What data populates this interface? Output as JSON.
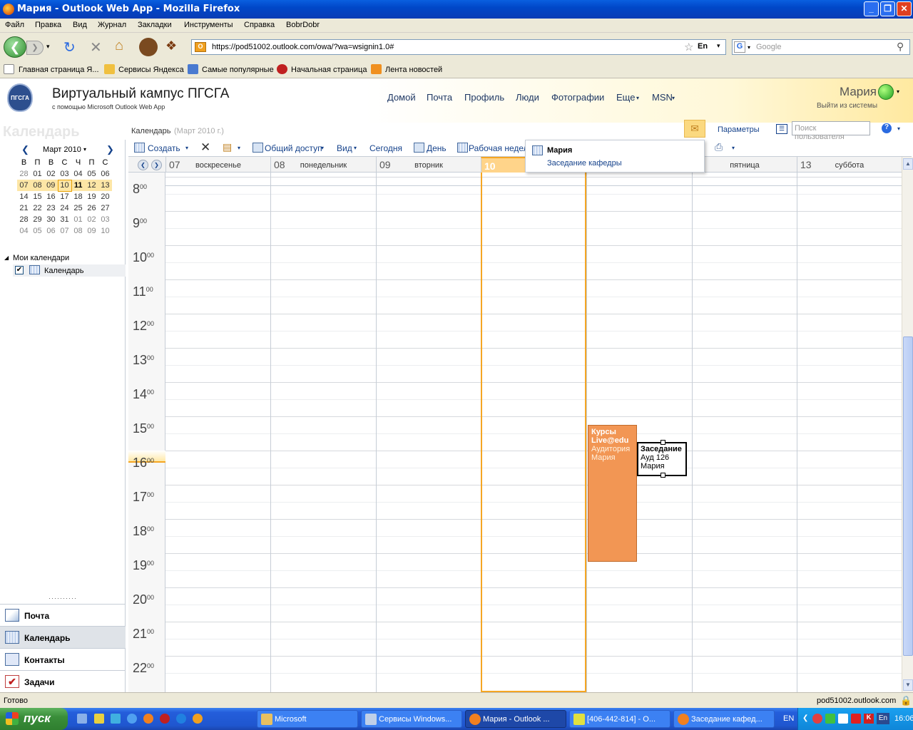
{
  "window": {
    "title": "Мария - Outlook Web App - Mozilla Firefox",
    "min": "_",
    "max": "❐",
    "close": "✕"
  },
  "menu": [
    "Файл",
    "Правка",
    "Вид",
    "Журнал",
    "Закладки",
    "Инструменты",
    "Справка",
    "BobrDobr"
  ],
  "nav": {
    "url": "https://pod51002.outlook.com/owa/?wa=wsignin1.0#",
    "lang": "En",
    "search_placeholder": "Google"
  },
  "bookmarks": [
    "Главная страница Я...",
    "Сервисы Яндекса",
    "Самые популярные",
    "Начальная страница",
    "Лента новостей"
  ],
  "owa": {
    "logo": "ПГСГА",
    "title": "Виртуальный кампус ПГСГА",
    "subtitle": "с помощью Microsoft Outlook Web App",
    "menu": [
      "Домой",
      "Почта",
      "Профиль",
      "Люди",
      "Фотографии",
      "Еще",
      "MSN"
    ],
    "user": "Мария",
    "signout": "Выйти из системы",
    "params": "Параметры",
    "search_users_placeholder": "Поиск пользователя",
    "help": "?"
  },
  "page": {
    "heading": "Календарь",
    "breadcrumb": "Календарь",
    "breadcrumb_date": "(Март 2010 г.)"
  },
  "mini_calendar": {
    "month": "Март 2010",
    "weekdays": [
      "В",
      "П",
      "В",
      "С",
      "Ч",
      "П",
      "С"
    ],
    "weeks": [
      [
        "28",
        "01",
        "02",
        "03",
        "04",
        "05",
        "06"
      ],
      [
        "07",
        "08",
        "09",
        "10",
        "11",
        "12",
        "13"
      ],
      [
        "14",
        "15",
        "16",
        "17",
        "18",
        "19",
        "20"
      ],
      [
        "21",
        "22",
        "23",
        "24",
        "25",
        "26",
        "27"
      ],
      [
        "28",
        "29",
        "30",
        "31",
        "01",
        "02",
        "03"
      ],
      [
        "04",
        "05",
        "06",
        "07",
        "08",
        "09",
        "10"
      ]
    ],
    "selected_week": 1,
    "today": "10"
  },
  "my_calendars": {
    "label": "Мои календари",
    "items": [
      "Календарь"
    ]
  },
  "modules": [
    "Почта",
    "Календарь",
    "Контакты",
    "Задачи"
  ],
  "toolbar": {
    "create": "Создать",
    "share": "Общий доступ",
    "view": "Вид",
    "today": "Сегодня",
    "day": "День",
    "workweek": "Рабочая неделя"
  },
  "days": [
    {
      "num": "07",
      "name": "воскресенье"
    },
    {
      "num": "08",
      "name": "понедельник"
    },
    {
      "num": "09",
      "name": "вторник"
    },
    {
      "num": "10",
      "name": ""
    },
    {
      "num": "11",
      "name": ""
    },
    {
      "num": "12",
      "name": "пятница"
    },
    {
      "num": "13",
      "name": "суббота"
    }
  ],
  "hours": [
    "8",
    "9",
    "10",
    "11",
    "12",
    "13",
    "14",
    "15",
    "16",
    "17",
    "18",
    "19",
    "20",
    "21",
    "22"
  ],
  "hour_suffix": "00",
  "events": [
    {
      "title": "Курсы Live@edu",
      "location": "Аудитория",
      "owner": "Мария",
      "start": "15:00",
      "end": "19:00",
      "day": "11",
      "color": "#f29654"
    },
    {
      "title": "Заседание",
      "location": "Ауд 126",
      "owner": "Мария",
      "start": "15:30",
      "end": "16:30",
      "day": "11",
      "color": "#ffffff"
    }
  ],
  "popup": {
    "name": "Мария",
    "subject": "Заседание кафедры"
  },
  "status": {
    "left": "Готово",
    "right": "pod51002.outlook.com"
  },
  "taskbar": {
    "start": "пуск",
    "tasks": [
      "Microsoft",
      "Сервисы Windows...",
      "Мария - Outlook ...",
      "[406-442-814] - O...",
      "Заседание кафед..."
    ],
    "lang": "EN",
    "tray_lang": "En",
    "clock": "16:06"
  }
}
